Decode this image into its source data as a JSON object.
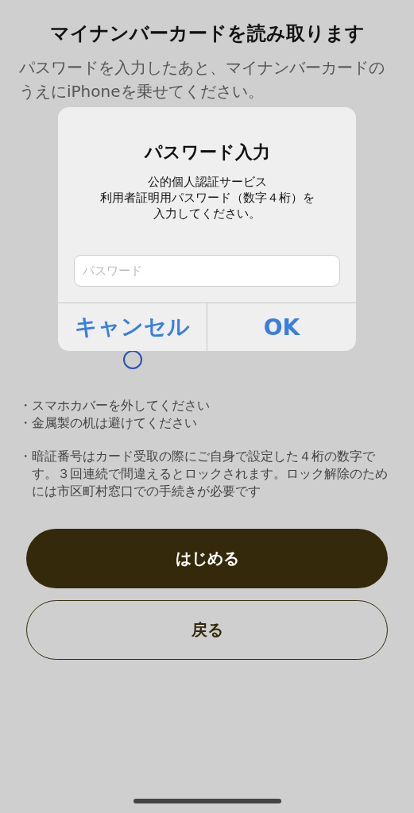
{
  "title": "マイナンバーカードを読み取ります",
  "instruction": "パスワードを入力したあと、マイナンバーカードのうえにiPhoneを乗せてください。",
  "notes": [
    "・スマホカバーを外してください",
    "・金属製の机は避けてください"
  ],
  "warning": "・暗証番号はカード受取の際にご自身で設定した４桁の数字です。３回連続で間違えるとロックされます。ロック解除のためには市区町村窓口での手続きが必要です",
  "buttons": [
    {
      "label": "はじめる",
      "kind": "primary"
    },
    {
      "label": "戻る",
      "kind": "secondary"
    }
  ],
  "dialog": {
    "title": "パスワード入力",
    "message": [
      "公的個人認証サービス",
      "利用者証明用パスワード（数字４桁）を",
      "入力してください。"
    ],
    "placeholder": "パスワード",
    "actions": [
      "キャンセル",
      "OK"
    ]
  }
}
